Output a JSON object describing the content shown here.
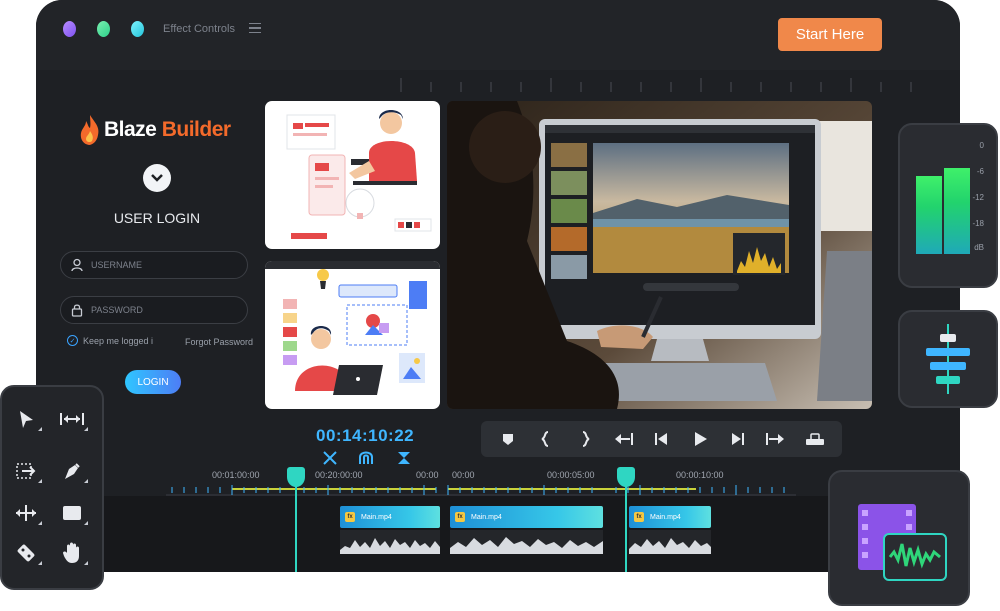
{
  "topbar": {
    "title": "Effect Controls",
    "cta": "Start Here"
  },
  "login": {
    "brand_part1": "Blaze ",
    "brand_part2": "Builder",
    "title": "USER LOGIN",
    "username_placeholder": "USERNAME",
    "password_placeholder": "PASSWORD",
    "keep_logged": "Keep me logged i",
    "forgot": "Forgot Password",
    "button": "LOGIN"
  },
  "player": {
    "timecode": "00:14:10:22"
  },
  "timeline": {
    "labels": [
      "00:01:00:00",
      "00:20:00:00",
      "00:00",
      "00:00",
      "00:00:05:00",
      "00:00:10:00"
    ],
    "clips": [
      {
        "name": "Main.mp4",
        "fx": "fx"
      },
      {
        "name": "Main.mp4",
        "fx": "fx"
      },
      {
        "name": "Main.mp4",
        "fx": "fx"
      }
    ]
  },
  "meter": {
    "labels": [
      "0",
      "-6",
      "-12",
      "-18",
      "dB"
    ]
  },
  "colors": {
    "accent_orange": "#f0884a",
    "accent_cyan": "#2fd6c2",
    "timecode_blue": "#3fb6ff",
    "brand_orange": "#f36a2b"
  },
  "icons": [
    "menu-icon",
    "chevron-down-icon",
    "user-icon",
    "lock-icon",
    "check-icon",
    "cut-icon",
    "magnet-icon",
    "split-icon",
    "marker-icon",
    "brace-left-icon",
    "brace-right-icon",
    "go-start-icon",
    "step-back-icon",
    "play-icon",
    "step-forward-icon",
    "go-end-icon",
    "mixer-icon",
    "select-arrow-icon",
    "ripple-icon",
    "enter-icon",
    "pen-icon",
    "move-icon",
    "rectangle-icon",
    "razor-icon",
    "hand-icon",
    "align-icon",
    "media-icon"
  ]
}
